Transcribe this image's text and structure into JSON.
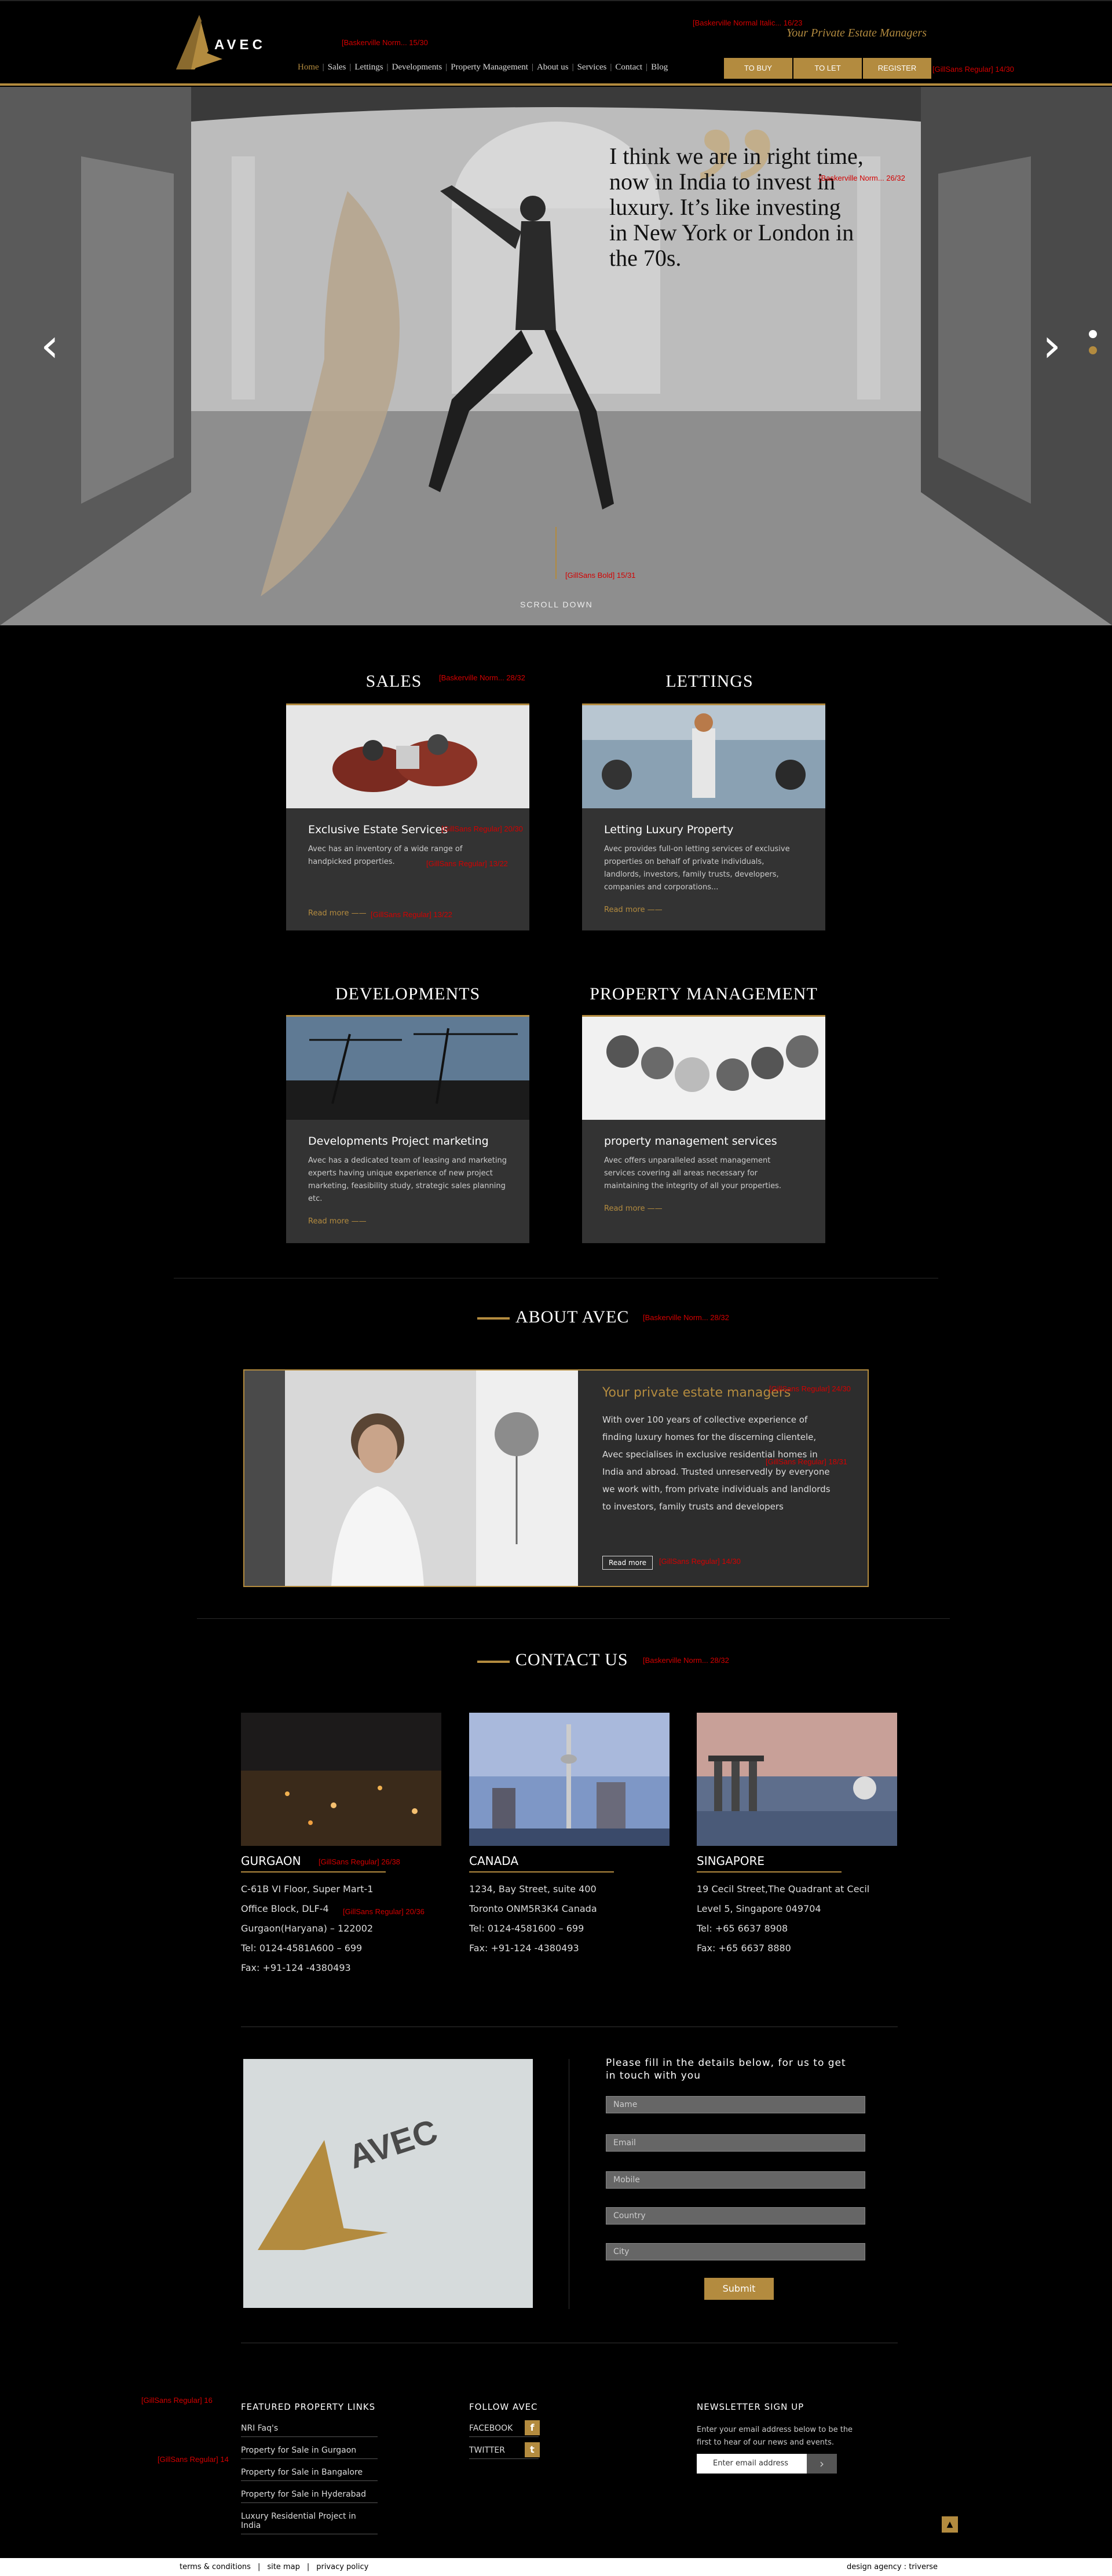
{
  "header": {
    "logo_text": "AVEC",
    "tagline": "Your Private Estate Managers",
    "nav": [
      "Home",
      "Sales",
      "Lettings",
      "Developments",
      "Property Management",
      "About us",
      "Services",
      "Contact",
      "Blog"
    ],
    "buttons": [
      "TO BUY",
      "TO LET",
      "REGISTER"
    ],
    "notes": {
      "logo": "[Baskerville Norm... 15/30",
      "tagline": "[Baskerville Normal Italic... 16/23",
      "register": "[GillSans Regular] 14/30"
    }
  },
  "hero": {
    "quote": "I think we are in right time, now in India to invest in luxury. It’s like investing in New York or London in the 70s.",
    "scroll": "SCROLL DOWN",
    "notes": {
      "quote": "[Baskerville Norm... 26/32",
      "scroll": "[GillSans Bold] 15/31"
    }
  },
  "services": [
    {
      "section": "SALES",
      "title": "Exclusive Estate Services",
      "text": "Avec has an inventory of a wide range of handpicked properties.",
      "more": "Read more ——"
    },
    {
      "section": "LETTINGS",
      "title": "Letting Luxury Property",
      "text": "Avec provides full-on letting services of exclusive properties on behalf of private individuals, landlords, investors, family trusts, developers, companies and corporations...",
      "more": "Read more ——"
    },
    {
      "section": "DEVELOPMENTS",
      "title": "Developments Project marketing",
      "text": "Avec has a dedicated team of leasing and marketing experts having unique experience of new project marketing, feasibility study, strategic sales planning etc.",
      "more": "Read more ——"
    },
    {
      "section": "PROPERTY MANAGEMENT",
      "title": "property management services",
      "text": "Avec offers unparalleled asset management services covering all areas necessary for maintaining the integrity of all your properties.",
      "more": "Read more ——"
    }
  ],
  "service_notes": {
    "sales_title": "[Baskerville Norm... 28/32",
    "card_title": "[GillSans Regular] 20/30",
    "card_text": "[GillSans Regular] 13/22",
    "more": "[GillSans Regular] 13/22"
  },
  "about": {
    "heading": "ABOUT AVEC",
    "heading_note": "[Baskerville Norm... 28/32",
    "title": "Your private estate managers",
    "title_note": "[GillSans Regular] 24/30",
    "text": "With over 100 years of collective experience of finding luxury homes for the discerning clientele, Avec specialises in exclusive residential homes in India and abroad. Trusted unreservedly by everyone we work with, from private individuals and landlords to investors, family trusts and developers",
    "text_note": "[GillSans Regular] 18/31",
    "button": "Read more",
    "button_note": "[GillSans Regular] 14/30"
  },
  "contact": {
    "heading": "CONTACT US",
    "heading_note": "[Baskerville Norm... 28/32",
    "offices": [
      {
        "city": "GURGAON",
        "lines": [
          "C-61B VI Floor, Super Mart-1",
          "Office Block, DLF-4",
          "Gurgaon(Haryana) – 122002",
          "Tel: 0124-4581A600 – 699",
          "Fax: +91-124 -4380493"
        ]
      },
      {
        "city": "CANADA",
        "lines": [
          "1234, Bay Street, suite 400",
          "Toronto ONM5R3K4 Canada",
          "Tel: 0124-4581600 – 699",
          "Fax: +91-124 -4380493"
        ]
      },
      {
        "city": "SINGAPORE",
        "lines": [
          "19 Cecil Street,The Quadrant at Cecil",
          "Level 5, Singapore 049704",
          "Tel: +65 6637 8908",
          "Fax: +65 6637 8880"
        ]
      }
    ],
    "notes": {
      "city": "[GillSans Regular] 26/38",
      "address": "[GillSans Regular] 20/36"
    }
  },
  "form": {
    "title": "Please fill in the details below, for us to get in touch with you",
    "fields": [
      "Name",
      "Email",
      "Mobile",
      "Country",
      "City"
    ],
    "submit": "Submit"
  },
  "footer": {
    "featured_heading": "FEATURED PROPERTY LINKS",
    "featured_links": [
      "NRI Faq's",
      "Property for Sale in Gurgaon",
      "Property for Sale in Bangalore",
      "Property for Sale in Hyderabad",
      "Luxury Residential Project in India"
    ],
    "follow_heading": "FOLLOW AVEC",
    "social": [
      "FACEBOOK",
      "TWITTER"
    ],
    "newsletter_heading": "NEWSLETTER SIGN UP",
    "newsletter_text": "Enter your email address below to be the first to hear of our news and events.",
    "newsletter_placeholder": "Enter email address",
    "notes": {
      "heading": "[GillSans Regular] 16",
      "links": "[GillSans Regular] 14"
    },
    "bottom_links": [
      "terms & conditions",
      "site map",
      "privacy policy"
    ],
    "credit": "design agency : triverse"
  },
  "colors": {
    "accent": "#b38b3f",
    "card": "#333333",
    "note": "#d40000"
  }
}
